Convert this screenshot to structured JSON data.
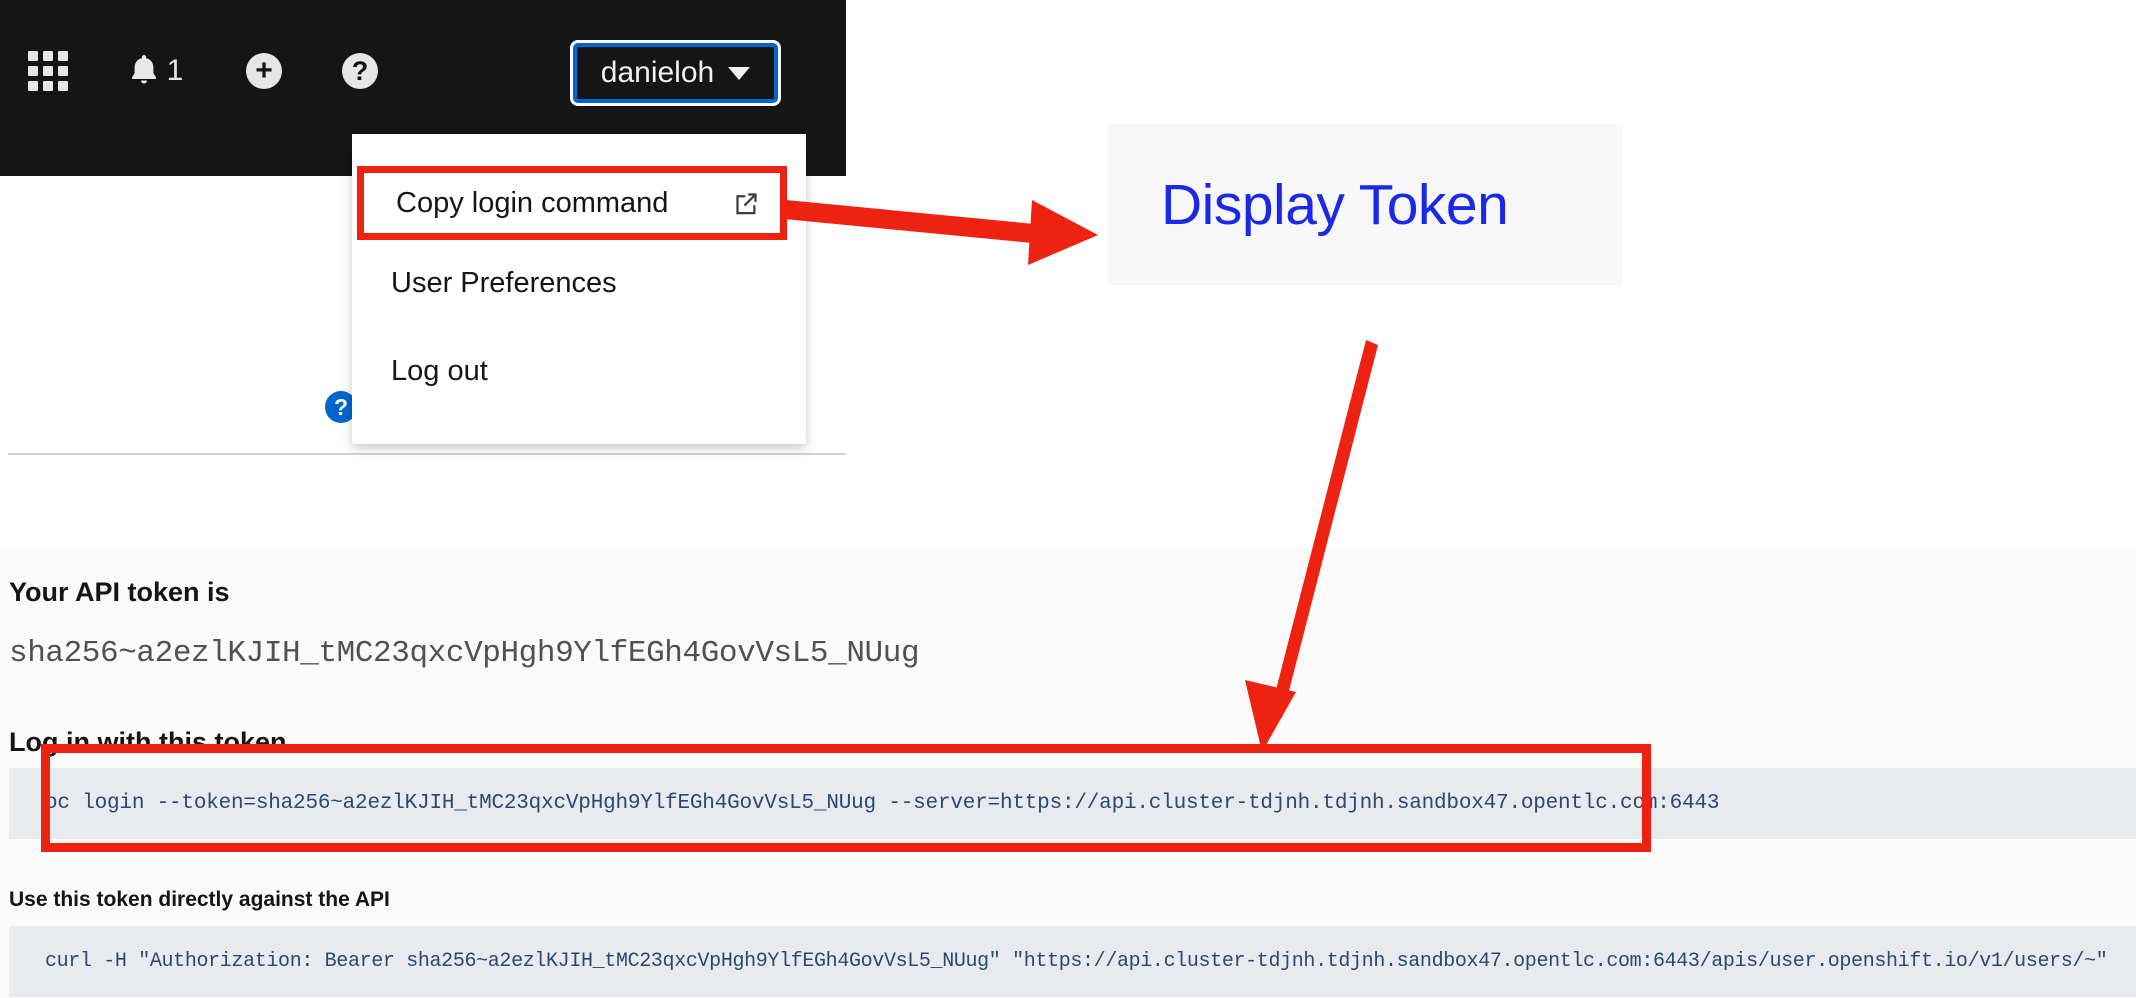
{
  "masthead": {
    "tools": [
      {
        "name": "application-launcher",
        "icon": "grid-icon",
        "label": ""
      },
      {
        "name": "notifications",
        "icon": "bell-icon",
        "badge": "1"
      },
      {
        "name": "quick-add",
        "icon": "plus-circle-icon",
        "glyph": "+"
      },
      {
        "name": "help",
        "icon": "question-circle-icon",
        "glyph": "?"
      }
    ],
    "user_button": {
      "username": "danieloh",
      "caret": "chevron-down-icon"
    }
  },
  "user_dropdown": {
    "items": [
      {
        "label": "Copy login command",
        "icon": "external-link-icon",
        "highlighted": true
      },
      {
        "label": "User Preferences",
        "icon": "",
        "highlighted": false
      },
      {
        "label": "Log out",
        "icon": "",
        "highlighted": false
      }
    ]
  },
  "callout": {
    "display_token_label": "Display Token"
  },
  "token_page": {
    "api_token_heading": "Your API token is",
    "api_token_value": "sha256~a2ezlKJIH_tMC23qxcVpHgh9YlfEGh4GovVsL5_NUug",
    "login_heading": "Log in with this token",
    "login_command": "oc login --token=sha256~a2ezlKJIH_tMC23qxcVpHgh9YlfEGh4GovVsL5_NUug --server=https://api.cluster-tdjnh.tdjnh.sandbox47.opentlc.com:6443",
    "direct_api_heading": "Use this token directly against the API",
    "curl_command": "curl -H \"Authorization: Bearer sha256~a2ezlKJIH_tMC23qxcVpHgh9YlfEGh4GovVsL5_NUug\" \"https://api.cluster-tdjnh.tdjnh.sandbox47.opentlc.com:6443/apis/user.openshift.io/v1/users/~\""
  },
  "colors": {
    "annotation_red": "#ee2211",
    "link_blue": "#1b28e8",
    "focus_blue": "#0066cc",
    "masthead_black": "#151515",
    "code_text": "#264a75",
    "code_bg": "#e9eaed"
  }
}
